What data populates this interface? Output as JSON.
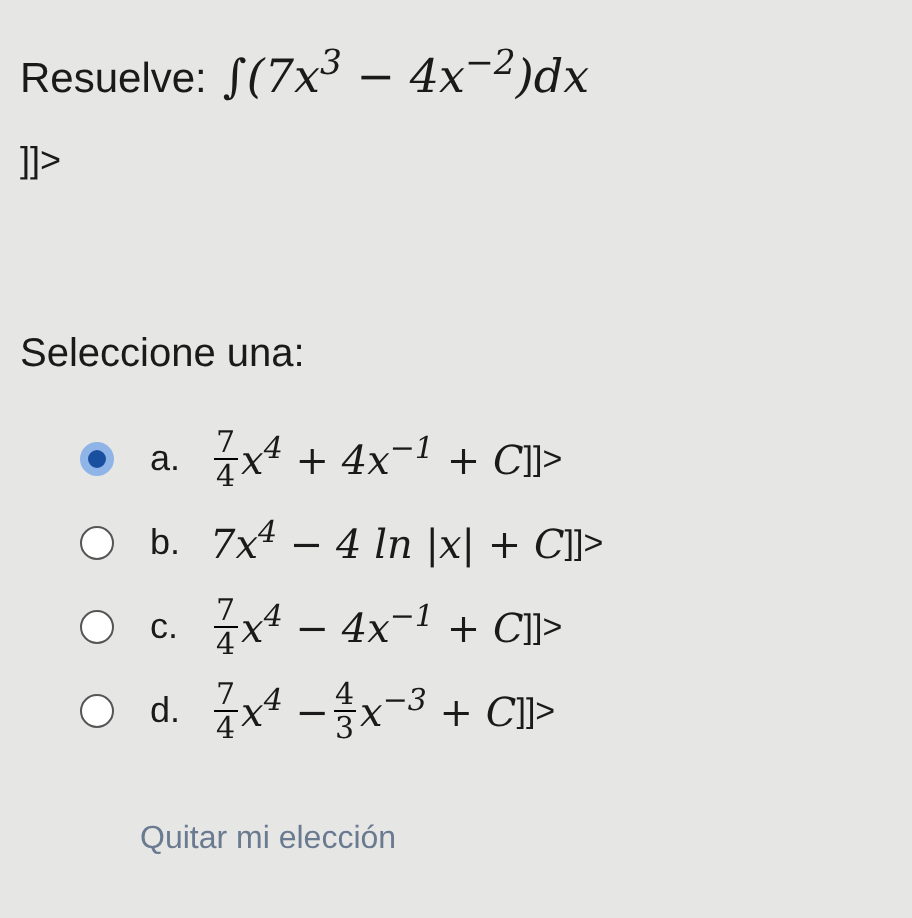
{
  "question": {
    "label": "Resuelve:",
    "formula": "∫(7x$^{3}$ − 4x$^{−2}$)dx",
    "suffix": "]]>"
  },
  "prompt": "Seleccione una:",
  "options": [
    {
      "letter": "a.",
      "selected": true,
      "formula": [
        {
          "kind": "frac",
          "num": "7",
          "den": "4"
        },
        {
          "kind": "text",
          "text": "x$^{4}$ + 4x$^{−1}$ + C"
        }
      ],
      "suffix": "]]>"
    },
    {
      "letter": "b.",
      "selected": false,
      "formula": [
        {
          "kind": "text",
          "text": "7x$^{4}$ − 4 ln |x| + C"
        }
      ],
      "suffix": "]]>"
    },
    {
      "letter": "c.",
      "selected": false,
      "formula": [
        {
          "kind": "frac",
          "num": "7",
          "den": "4"
        },
        {
          "kind": "text",
          "text": "x$^{4}$ − 4x$^{−1}$ + C"
        }
      ],
      "suffix": "]]>"
    },
    {
      "letter": "d.",
      "selected": false,
      "formula": [
        {
          "kind": "frac",
          "num": "7",
          "den": "4"
        },
        {
          "kind": "text",
          "text": "x$^{4}$ − "
        },
        {
          "kind": "frac",
          "num": "4",
          "den": "3"
        },
        {
          "kind": "text",
          "text": "x$^{−3}$ + C"
        }
      ],
      "suffix": "]]>"
    }
  ],
  "clear_link": "Quitar mi elección"
}
